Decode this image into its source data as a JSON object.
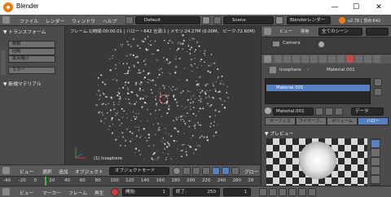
{
  "window": {
    "title": "Blender",
    "minimize": "—",
    "maximize": "☐",
    "close": "✕"
  },
  "infobar": {
    "menus": [
      "ファイル",
      "レンダー",
      "ウィンドウ",
      "ヘルプ"
    ],
    "layout": "Default",
    "scene": "Scene",
    "engine": "Blenderレンダー",
    "version": "v2.78 | 頂点:642"
  },
  "toolshelf": {
    "transform_header": "▼ トランスフォーム",
    "buttons": [
      "移動",
      "回転",
      "拡大縮小",
      "ミラー"
    ],
    "new_material_header": "▼ 新規マテリアル"
  },
  "viewport": {
    "info": "フレーム:1|時間:00:00.01 | ハロー・642 光源:1 | メモリ:24.27M (0.00M、 ピーク:72.60M)",
    "object_name": "(1) Icosphere"
  },
  "viewport_header": {
    "menus": [
      "ビュー",
      "選択",
      "追加",
      "オブジェクト"
    ],
    "mode": "オブジェクトモード",
    "global": "グロー"
  },
  "timeline": {
    "ticks": [
      "-40",
      "-20",
      "0",
      "20",
      "40",
      "60",
      "80",
      "100",
      "120",
      "140",
      "160",
      "180",
      "200",
      "220",
      "240",
      "260",
      "28"
    ],
    "menus": [
      "ビュー",
      "マーカー",
      "フレーム",
      "再生"
    ],
    "start_label": "開始:",
    "start_value": "1",
    "end_label": "終了:",
    "end_value": "250",
    "current_frame": "1"
  },
  "props": {
    "outliner_menus": [
      "ビュー",
      "検索"
    ],
    "outliner_filter": "全てのシーン",
    "camera_label": "Camera",
    "breadcrumb": [
      "Icosphere",
      "Material.001"
    ],
    "material_slot": "Material.001",
    "material_field": "Material.001",
    "data_label": "データ",
    "halo_tabs": [
      "サーフェス",
      "ワイヤーフ...",
      "ボリューム",
      "ハロー"
    ],
    "preview_header": "▼ プレビュー",
    "accent": "#5680c2"
  }
}
